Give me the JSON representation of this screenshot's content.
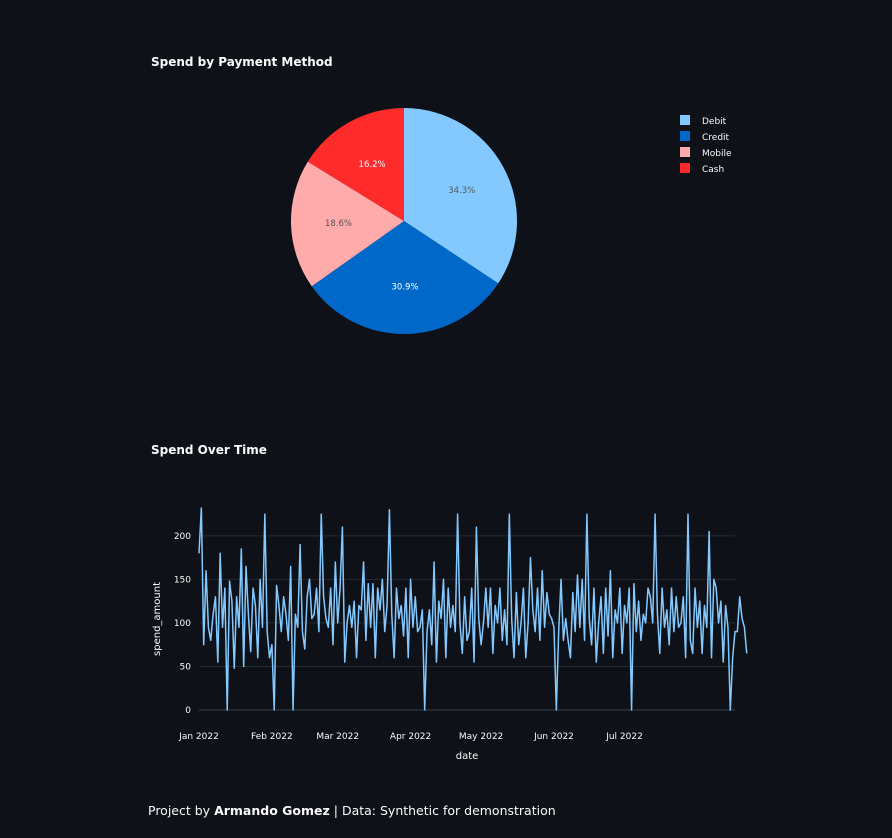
{
  "charts": {
    "pie_title": "Spend by Payment Method",
    "line_title": "Spend Over Time"
  },
  "footer": {
    "prefix": "Project by",
    "author": "Armando Gomez",
    "suffix": "| Data: Synthetic for demonstration"
  },
  "chart_data": [
    {
      "type": "pie",
      "title": "Spend by Payment Method",
      "labels": [
        "Debit",
        "Credit",
        "Mobile",
        "Cash"
      ],
      "values": [
        34.3,
        30.9,
        18.6,
        16.2
      ],
      "slice_labels": [
        "34.3%",
        "30.9%",
        "18.6%",
        "16.2%"
      ],
      "colors": [
        "#83c9ff",
        "#0068c9",
        "#ffabab",
        "#ff2b2b"
      ],
      "label_colors": [
        "#555555",
        "#ffffff",
        "#555555",
        "#ffffff"
      ],
      "legend_placement": "top-right"
    },
    {
      "type": "line",
      "title": "Spend Over Time",
      "xlabel": "date",
      "ylabel": "spend_amount",
      "x_start": "2022-01-01",
      "x_step_days": 1,
      "x_ticks": [
        "Jan 2022",
        "Feb 2022",
        "Mar 2022",
        "Apr 2022",
        "May 2022",
        "Jun 2022",
        "Jul 2022"
      ],
      "x_tick_dates": [
        "2022-01-01",
        "2022-02-01",
        "2022-03-01",
        "2022-04-01",
        "2022-05-01",
        "2022-06-01",
        "2022-07-01"
      ],
      "x_range": [
        "2022-01-01",
        "2022-08-17"
      ],
      "y_ticks": [
        0,
        50,
        100,
        150,
        200
      ],
      "ylim": [
        0,
        232
      ],
      "grid": true,
      "color": "#83c9ff",
      "values": [
        180,
        232,
        75,
        160,
        95,
        80,
        110,
        130,
        55,
        180,
        95,
        140,
        0,
        148,
        125,
        48,
        130,
        95,
        185,
        50,
        165,
        110,
        67,
        140,
        120,
        60,
        150,
        95,
        225,
        90,
        60,
        75,
        0,
        143,
        120,
        90,
        130,
        110,
        80,
        165,
        0,
        110,
        95,
        190,
        90,
        70,
        130,
        150,
        105,
        110,
        140,
        90,
        225,
        130,
        105,
        95,
        140,
        75,
        170,
        100,
        140,
        210,
        55,
        100,
        120,
        95,
        125,
        60,
        120,
        115,
        170,
        80,
        145,
        95,
        145,
        60,
        140,
        115,
        150,
        90,
        120,
        230,
        110,
        60,
        140,
        105,
        120,
        85,
        140,
        60,
        150,
        95,
        130,
        90,
        95,
        115,
        0,
        90,
        115,
        75,
        170,
        55,
        125,
        105,
        150,
        60,
        140,
        95,
        120,
        90,
        225,
        100,
        65,
        130,
        80,
        90,
        140,
        55,
        210,
        105,
        75,
        100,
        140,
        95,
        140,
        65,
        120,
        100,
        140,
        80,
        115,
        75,
        225,
        105,
        60,
        135,
        75,
        100,
        140,
        60,
        100,
        175,
        115,
        90,
        140,
        80,
        160,
        95,
        135,
        110,
        105,
        95,
        0,
        90,
        150,
        80,
        105,
        80,
        60,
        135,
        90,
        155,
        95,
        150,
        80,
        225,
        105,
        75,
        140,
        55,
        100,
        130,
        65,
        140,
        85,
        160,
        60,
        115,
        100,
        140,
        65,
        120,
        100,
        140,
        0,
        145,
        90,
        125,
        80,
        110,
        100,
        140,
        130,
        100,
        225,
        110,
        65,
        140,
        95,
        115,
        75,
        140,
        90,
        130,
        95,
        100,
        130,
        60,
        225,
        80,
        65,
        140,
        95,
        125,
        65,
        120,
        95,
        205,
        60,
        150,
        140,
        100,
        125,
        55,
        120,
        95,
        0,
        60,
        90,
        90,
        130,
        105,
        95,
        65
      ]
    }
  ]
}
